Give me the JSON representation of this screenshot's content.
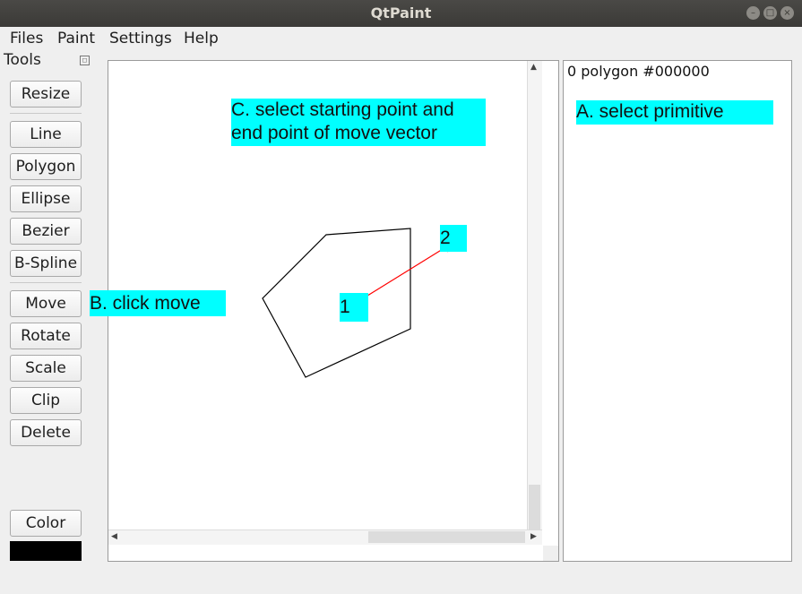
{
  "window": {
    "title": "QtPaint",
    "controls": [
      "minimize",
      "maximize",
      "close"
    ]
  },
  "menubar": {
    "items": [
      "Files",
      "Paint",
      "Settings",
      "Help"
    ]
  },
  "tools_dock": {
    "title": "Tools",
    "buttons": {
      "resize": "Resize",
      "line": "Line",
      "polygon": "Polygon",
      "ellipse": "Ellipse",
      "bezier": "Bezier",
      "bspline": "B-Spline",
      "move": "Move",
      "rotate": "Rotate",
      "scale": "Scale",
      "clip": "Clip",
      "delete": "Delete",
      "color": "Color"
    },
    "current_color": "#000000"
  },
  "canvas": {
    "polygon_color": "#000000",
    "move_vector_color": "#ff0000"
  },
  "primitive_list": {
    "items": [
      "0 polygon #000000"
    ]
  },
  "annotations": {
    "step_a": "A. select primitive",
    "step_b": "B. click move",
    "step_c_line1": "C. select starting point and",
    "step_c_line2": "end point of move vector",
    "point_1": "1",
    "point_2": "2",
    "highlight_color": "#00ffff"
  }
}
